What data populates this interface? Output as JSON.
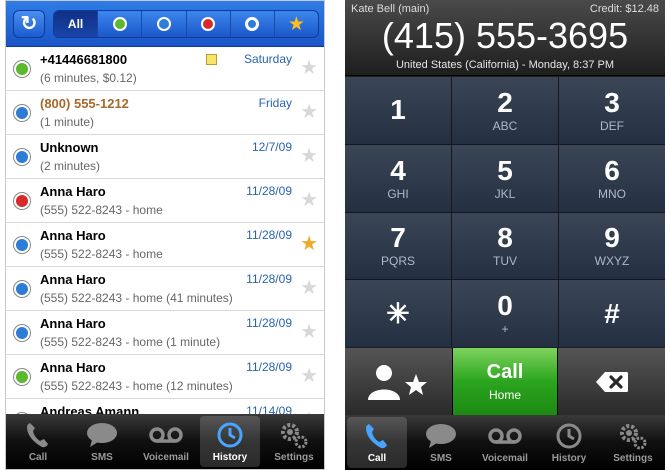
{
  "history_screen": {
    "filter_bar": {
      "all_label": "All"
    },
    "entries": [
      {
        "name": "+41446681800",
        "detail": "(6 minutes, $0.12)",
        "date": "Saturday",
        "status": "green",
        "starred": false,
        "has_note": true,
        "name_style": "normal"
      },
      {
        "name": "(800) 555-1212",
        "detail": "(1 minute)",
        "date": "Friday",
        "status": "blue",
        "starred": false,
        "has_note": false,
        "name_style": "orange"
      },
      {
        "name": "Unknown",
        "detail": "(2 minutes)",
        "date": "12/7/09",
        "status": "blue",
        "starred": false,
        "has_note": false,
        "name_style": "normal"
      },
      {
        "name": "Anna Haro",
        "detail": "(555) 522-8243 - home",
        "date": "11/28/09",
        "status": "red",
        "starred": false,
        "has_note": false,
        "name_style": "normal"
      },
      {
        "name": "Anna Haro",
        "detail": "(555) 522-8243 - home",
        "date": "11/28/09",
        "status": "blue",
        "starred": true,
        "has_note": false,
        "name_style": "normal"
      },
      {
        "name": "Anna Haro",
        "detail": "(555) 522-8243 - home (41 minutes)",
        "date": "11/28/09",
        "status": "blue",
        "starred": false,
        "has_note": false,
        "name_style": "normal"
      },
      {
        "name": "Anna Haro",
        "detail": "(555) 522-8243 - home (1 minute)",
        "date": "11/28/09",
        "status": "blue",
        "starred": false,
        "has_note": false,
        "name_style": "normal"
      },
      {
        "name": "Anna Haro",
        "detail": "(555) 522-8243 - home (12 minutes)",
        "date": "11/28/09",
        "status": "green",
        "starred": false,
        "has_note": false,
        "name_style": "normal"
      },
      {
        "name": "Andreas Amann",
        "detail": "",
        "date": "11/14/09",
        "status": "green",
        "starred": false,
        "has_note": false,
        "name_style": "normal"
      }
    ],
    "tabs": [
      {
        "label": "Call",
        "icon": "phone-icon",
        "active": false
      },
      {
        "label": "SMS",
        "icon": "sms-bubble-icon",
        "active": false
      },
      {
        "label": "Voicemail",
        "icon": "voicemail-icon",
        "active": false
      },
      {
        "label": "History",
        "icon": "clock-icon",
        "active": true
      },
      {
        "label": "Settings",
        "icon": "gears-icon",
        "active": false
      }
    ]
  },
  "dialer_screen": {
    "account": "Kate Bell (main)",
    "credit": "Credit: $12.48",
    "number": "(415) 555-3695",
    "location": "United States (California) - Monday, 8:37 PM",
    "keys": [
      {
        "digit": "1",
        "letters": ""
      },
      {
        "digit": "2",
        "letters": "ABC"
      },
      {
        "digit": "3",
        "letters": "DEF"
      },
      {
        "digit": "4",
        "letters": "GHI"
      },
      {
        "digit": "5",
        "letters": "JKL"
      },
      {
        "digit": "6",
        "letters": "MNO"
      },
      {
        "digit": "7",
        "letters": "PQRS"
      },
      {
        "digit": "8",
        "letters": "TUV"
      },
      {
        "digit": "9",
        "letters": "WXYZ"
      },
      {
        "digit": "✳",
        "letters": ""
      },
      {
        "digit": "0",
        "letters": "+"
      },
      {
        "digit": "#",
        "letters": ""
      }
    ],
    "call_label": "Call",
    "call_sub": "Home",
    "tabs": [
      {
        "label": "Call",
        "icon": "phone-icon",
        "active": true
      },
      {
        "label": "SMS",
        "icon": "sms-bubble-icon",
        "active": false
      },
      {
        "label": "Voicemail",
        "icon": "voicemail-icon",
        "active": false
      },
      {
        "label": "History",
        "icon": "clock-icon",
        "active": false
      },
      {
        "label": "Settings",
        "icon": "gears-icon",
        "active": false
      }
    ]
  },
  "colors": {
    "call_green": "#2ba51e",
    "filter_blue": "#1a55c7",
    "star_gold": "#f0a829"
  }
}
